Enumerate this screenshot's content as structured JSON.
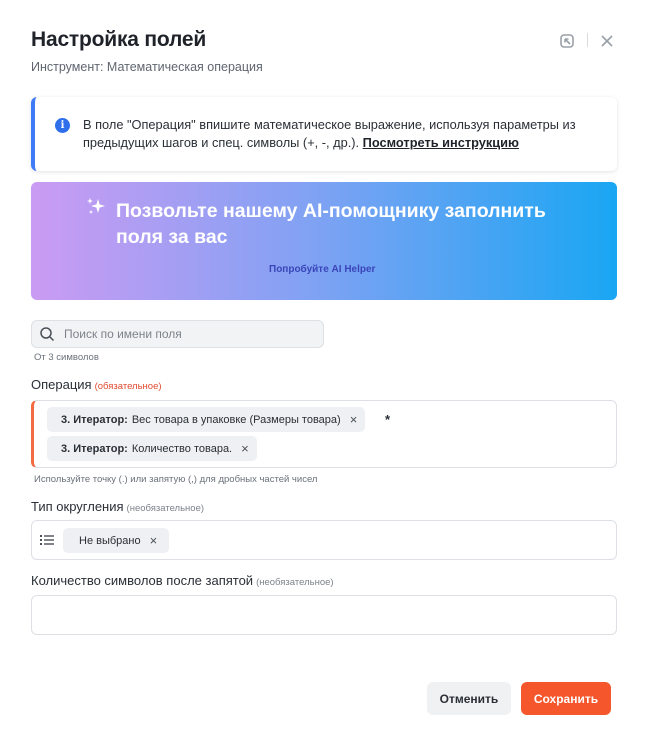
{
  "header": {
    "title": "Настройка полей",
    "subtitle": "Инструмент: Математическая операция"
  },
  "info": {
    "text": "В поле \"Операция\" впишите математическое выражение, используя параметры из предыдущих шагов и спец. символы (+, -, др.). ",
    "link": "Посмотреть инструкцию"
  },
  "ai_banner": {
    "text": "Позвольте нашему AI-помощнику заполнить поля за вас",
    "button": "Попробуйте AI Helper"
  },
  "search": {
    "placeholder": "Поиск по имени поля",
    "value": "",
    "hint": "От 3 символов"
  },
  "operation": {
    "label": "Операция",
    "required": "(обязательное)",
    "tags": [
      {
        "prefix": "3. Итератор:",
        "text": "Вес товара в упаковке (Размеры товара)"
      },
      {
        "prefix": "3. Итератор:",
        "text": "Количество товара."
      }
    ],
    "operator": "*",
    "hint": "Используйте точку (.) или запятую (,) для дробных частей чисел"
  },
  "rounding": {
    "label": "Тип округления",
    "optional": "(необязательное)",
    "value": "Не выбрано"
  },
  "decimals": {
    "label": "Количество символов после запятой",
    "optional": "(необязательное)",
    "value": ""
  },
  "footer": {
    "cancel": "Отменить",
    "save": "Сохранить"
  },
  "icons": {
    "remove": "×",
    "info": "i"
  },
  "colors": {
    "accent": "#f5562b",
    "info_border": "#3f7bf6",
    "required": "#e04a2e",
    "gradient_start": "#cb9bf3",
    "gradient_end": "#19a6f3"
  }
}
